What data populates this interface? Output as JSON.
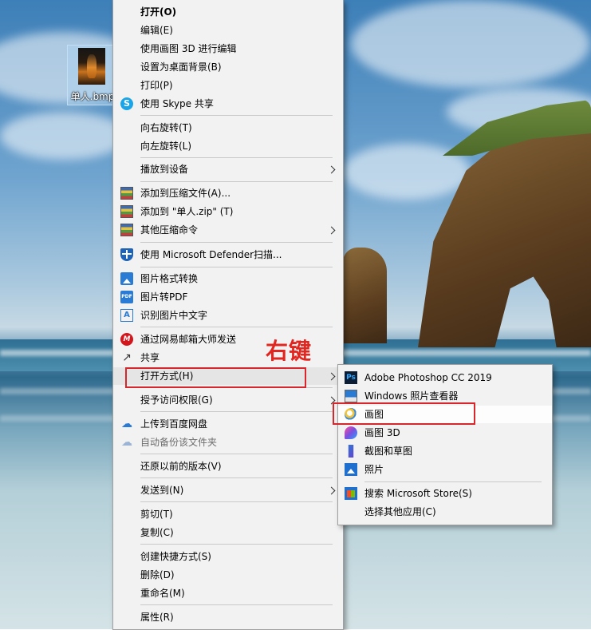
{
  "desktop": {
    "icon_label": "单人.bmp"
  },
  "context_menu": {
    "items": [
      {
        "label": "打开(O)"
      },
      {
        "label": "编辑(E)"
      },
      {
        "label": "使用画图 3D 进行编辑"
      },
      {
        "label": "设置为桌面背景(B)"
      },
      {
        "label": "打印(P)"
      },
      {
        "label": "使用 Skype 共享"
      },
      {
        "label": "向右旋转(T)"
      },
      {
        "label": "向左旋转(L)"
      },
      {
        "label": "播放到设备"
      },
      {
        "label": "添加到压缩文件(A)..."
      },
      {
        "label": "添加到 \"单人.zip\" (T)"
      },
      {
        "label": "其他压缩命令"
      },
      {
        "label": "使用 Microsoft Defender扫描..."
      },
      {
        "label": "图片格式转换"
      },
      {
        "label": "图片转PDF"
      },
      {
        "label": "识别图片中文字"
      },
      {
        "label": "通过网易邮箱大师发送"
      },
      {
        "label": "共享"
      },
      {
        "label": "打开方式(H)"
      },
      {
        "label": "授予访问权限(G)"
      },
      {
        "label": "上传到百度网盘"
      },
      {
        "label": "自动备份该文件夹"
      },
      {
        "label": "还原以前的版本(V)"
      },
      {
        "label": "发送到(N)"
      },
      {
        "label": "剪切(T)"
      },
      {
        "label": "复制(C)"
      },
      {
        "label": "创建快捷方式(S)"
      },
      {
        "label": "删除(D)"
      },
      {
        "label": "重命名(M)"
      },
      {
        "label": "属性(R)"
      }
    ]
  },
  "submenu": {
    "items": [
      {
        "label": "Adobe Photoshop CC 2019"
      },
      {
        "label": "Windows 照片查看器"
      },
      {
        "label": "画图"
      },
      {
        "label": "画图 3D"
      },
      {
        "label": "截图和草图"
      },
      {
        "label": "照片"
      },
      {
        "label": "搜索 Microsoft Store(S)"
      },
      {
        "label": "选择其他应用(C)"
      }
    ]
  },
  "annotation": {
    "text": "右键",
    "color": "#e2261f"
  },
  "icons": {
    "skype": "S",
    "pdf": "PDF",
    "ocr": "A",
    "mail": "M",
    "share": "↗",
    "cloud": "☁",
    "ps": "Ps"
  },
  "colors": {
    "menu_bg": "#f2f2f2",
    "highlight_border": "#d7262c"
  }
}
